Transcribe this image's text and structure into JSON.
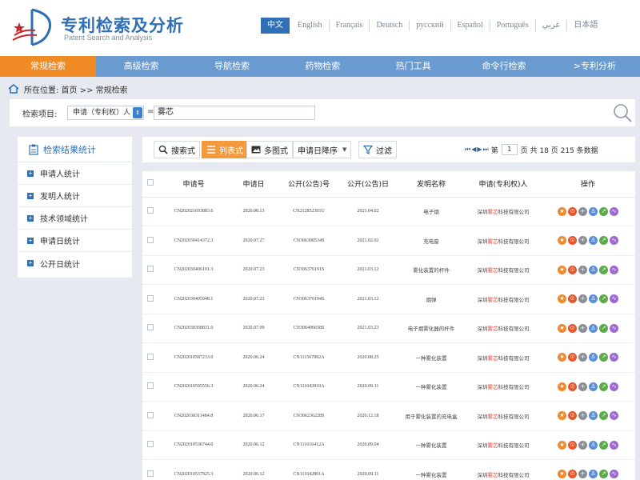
{
  "header": {
    "title": "专利检索及分析",
    "subtitle": "Patent Search and Analysis",
    "languages": [
      "中文",
      "English",
      "Français",
      "Deutsch",
      "русский",
      "Español",
      "Português",
      "عربي",
      "日本語"
    ]
  },
  "nav": {
    "items": [
      "常规检索",
      "高级检索",
      "导航检索",
      "药物检索",
      "热门工具",
      "命令行检索",
      ">专利分析"
    ]
  },
  "breadcrumb": "所在位置: 首页 >> 常规检索",
  "search": {
    "label": "检索项目:",
    "field": "申请（专利权）人",
    "equals": "=",
    "value": "雾芯"
  },
  "sidebar": {
    "title": "检索结果统计",
    "items": [
      "申请人统计",
      "发明人统计",
      "技术领域统计",
      "申请日统计",
      "公开日统计"
    ]
  },
  "toolbar": {
    "search_view": "搜索式",
    "list_view": "列表式",
    "image_view": "多图式",
    "sort": "申请日降序",
    "filter": "过滤",
    "page_prefix": "第",
    "page": "1",
    "page_suffix": "页 共 18 页 215 条数据"
  },
  "table": {
    "headers": [
      "申请号",
      "申请日",
      "公开(公告)号",
      "公开(公告)日",
      "发明名称",
      "申请(专利权)人",
      "操作"
    ],
    "applicant_prefix": "深圳",
    "applicant_highlight": "雾芯",
    "applicant_suffix": "科技有限公司",
    "rows": [
      {
        "app_no": "CN202021693883.6",
        "app_date": "2020.08.13",
        "pub_no": "CN212852301U",
        "pub_date": "2021.04.02",
        "title": "电子烟"
      },
      {
        "app_no": "CN202030414372.3",
        "app_date": "2020.07.27",
        "pub_no": "CN306308534S",
        "pub_date": "2021.02.02",
        "title": "充电座"
      },
      {
        "app_no": "CN202030406101.3",
        "app_date": "2020.07.23",
        "pub_no": "CN306376191S",
        "pub_date": "2021.03.12",
        "title": "雾化装置的杆件"
      },
      {
        "app_no": "CN202030405948.1",
        "app_date": "2020.07.23",
        "pub_no": "CN306376194S",
        "pub_date": "2021.03.12",
        "title": "烟弹"
      },
      {
        "app_no": "CN202030368831.0",
        "app_date": "2020.07.09",
        "pub_no": "CN306406658S",
        "pub_date": "2021.03.23",
        "title": "电子烟雾化器的杆件"
      },
      {
        "app_no": "CN202010587233.0",
        "app_date": "2020.06.24",
        "pub_no": "CN111567892A",
        "pub_date": "2020.08.25",
        "title": "一种雾化装置"
      },
      {
        "app_no": "CN202010595556.3",
        "app_date": "2020.06.24",
        "pub_no": "CN111642810A",
        "pub_date": "2020.09.11",
        "title": "一种雾化装置"
      },
      {
        "app_no": "CN202030311484.8",
        "app_date": "2020.06.17",
        "pub_no": "CN306236228S",
        "pub_date": "2020.12.18",
        "title": "用于雾化装置的充电盒"
      },
      {
        "app_no": "CN202010536744.0",
        "app_date": "2020.06.12",
        "pub_no": "CN111616412A",
        "pub_date": "2020.09.04",
        "title": "一种雾化装置"
      },
      {
        "app_no": "CN202010537925.3",
        "app_date": "2020.06.12",
        "pub_no": "CN111642801A",
        "pub_date": "2020.09.11",
        "title": "一种雾化装置"
      }
    ],
    "ops": [
      {
        "icon": "collect-icon",
        "color": "#ef8a2c",
        "glyph": "★"
      },
      {
        "icon": "detail-icon",
        "color": "#e4572e",
        "glyph": "⊙"
      },
      {
        "icon": "add-icon",
        "color": "#8a8f96",
        "glyph": "+"
      },
      {
        "icon": "user-icon",
        "color": "#5a8fd6",
        "glyph": "♙"
      },
      {
        "icon": "chart-icon",
        "color": "#5aab48",
        "glyph": "↗"
      },
      {
        "icon": "trend-icon",
        "color": "#9b6bd0",
        "glyph": "∿"
      }
    ]
  },
  "colors": {
    "brand": "#2f6fb5",
    "nav": "#6a9bd0",
    "accent": "#f08a24",
    "highlight": "#e23b2f"
  }
}
